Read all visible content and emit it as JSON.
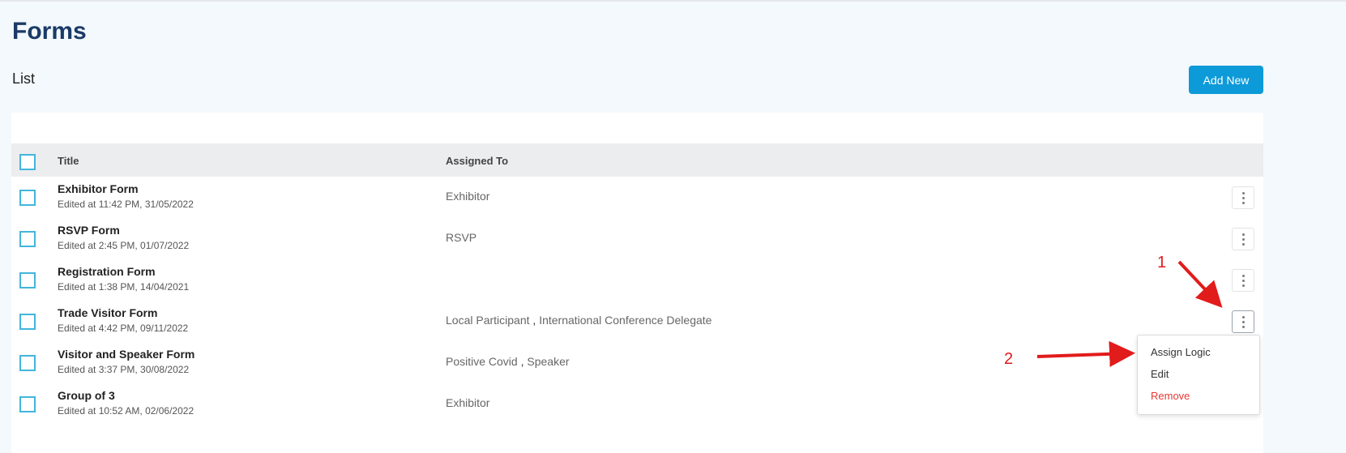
{
  "page": {
    "title": "Forms",
    "list_label": "List",
    "add_button": "Add New"
  },
  "table": {
    "columns": [
      "Title",
      "Assigned To"
    ],
    "rows": [
      {
        "title": "Exhibitor Form",
        "edited": "Edited at 11:42 PM, 31/05/2022",
        "assigned": [
          "Exhibitor"
        ]
      },
      {
        "title": "RSVP Form",
        "edited": "Edited at 2:45 PM, 01/07/2022",
        "assigned": [
          "RSVP"
        ]
      },
      {
        "title": "Registration Form",
        "edited": "Edited at 1:38 PM, 14/04/2021",
        "assigned": []
      },
      {
        "title": "Trade Visitor Form",
        "edited": "Edited at 4:42 PM, 09/11/2022",
        "assigned": [
          "Local Participant",
          "International Conference Delegate"
        ]
      },
      {
        "title": "Visitor and Speaker Form",
        "edited": "Edited at 3:37 PM, 30/08/2022",
        "assigned": [
          "Positive Covid",
          "Speaker"
        ]
      },
      {
        "title": "Group of 3",
        "edited": "Edited at 10:52 AM, 02/06/2022",
        "assigned": [
          "Exhibitor"
        ]
      }
    ],
    "assigned_separator": " , "
  },
  "menu": {
    "items": [
      "Assign Logic",
      "Edit",
      "Remove"
    ]
  },
  "annotations": {
    "one": "1",
    "two": "2"
  },
  "colors": {
    "accent": "#0d9ad8",
    "title": "#1b3a67",
    "danger": "#e53935",
    "annotation": "#e21b1b",
    "checkbox": "#43b5dd"
  },
  "icons": {
    "row_actions": "vertical-ellipsis-icon"
  }
}
